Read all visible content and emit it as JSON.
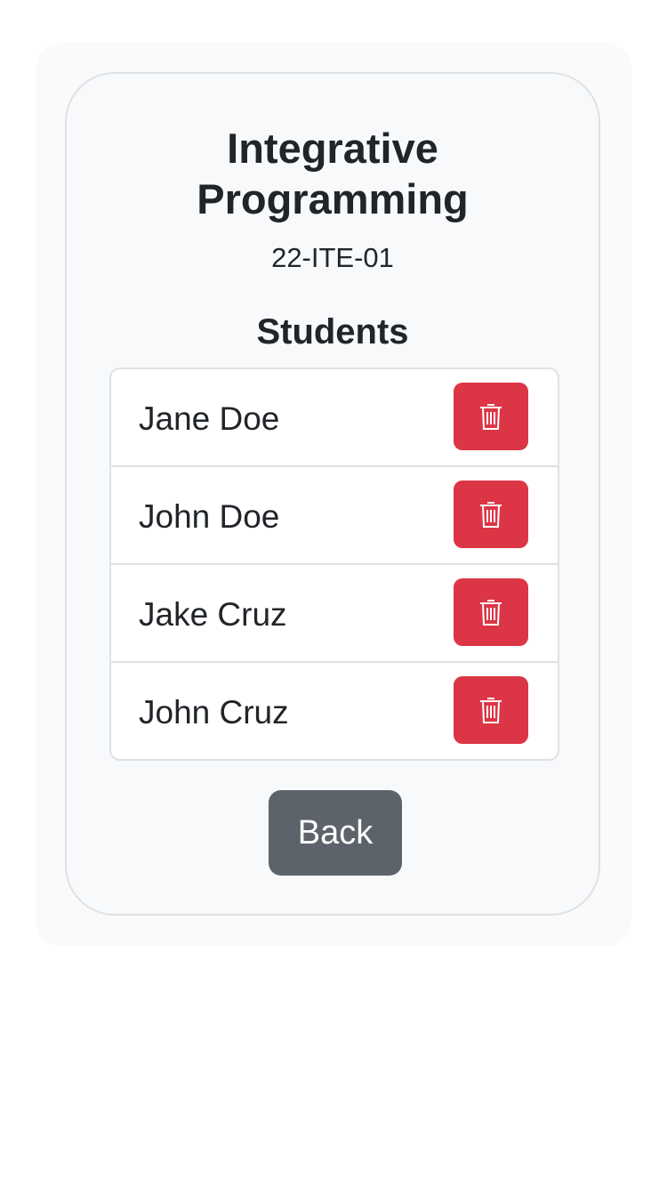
{
  "course": {
    "title_line1": "Integrative",
    "title_line2": "Programming",
    "code": "22-ITE-01"
  },
  "students_section": {
    "heading": "Students",
    "students": [
      {
        "name": "Jane Doe"
      },
      {
        "name": "John Doe"
      },
      {
        "name": "Jake Cruz"
      },
      {
        "name": "John Cruz"
      }
    ],
    "delete_icon": "trash-icon"
  },
  "actions": {
    "back_label": "Back"
  },
  "colors": {
    "danger": "#dc3545",
    "secondary": "#5c636a",
    "card_background": "#f8f9fa",
    "border": "#dee2e6"
  }
}
